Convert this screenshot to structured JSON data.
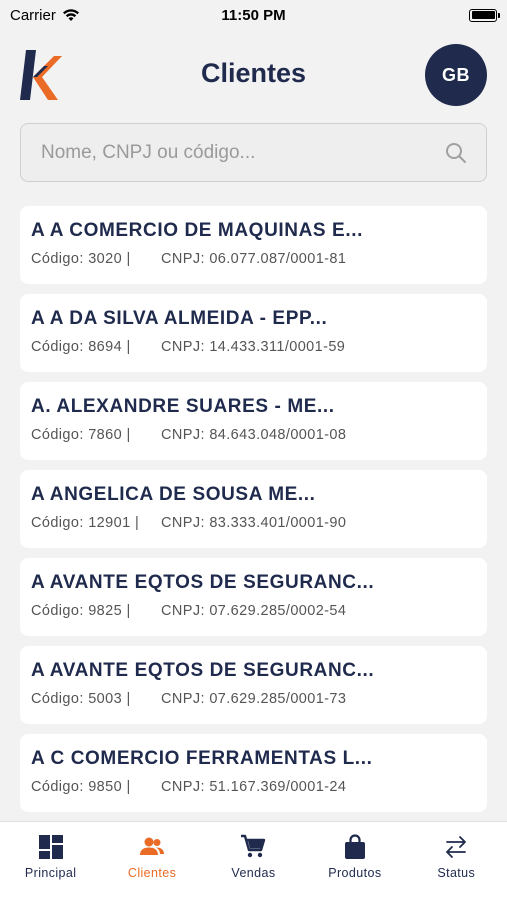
{
  "status_bar": {
    "carrier": "Carrier",
    "time": "11:50 PM"
  },
  "header": {
    "title": "Clientes",
    "avatar_initials": "GB"
  },
  "search": {
    "placeholder": "Nome, CNPJ ou código..."
  },
  "clients": [
    {
      "name": "A A COMERCIO DE MAQUINAS E...",
      "code": "Código: 3020 |",
      "cnpj": "CNPJ: 06.077.087/0001-81"
    },
    {
      "name": "A A DA SILVA ALMEIDA - EPP...",
      "code": "Código: 8694 |",
      "cnpj": "CNPJ: 14.433.311/0001-59"
    },
    {
      "name": "A. ALEXANDRE SUARES - ME...",
      "code": "Código: 7860 |",
      "cnpj": "CNPJ: 84.643.048/0001-08"
    },
    {
      "name": "A ANGELICA DE SOUSA ME...",
      "code": "Código: 12901 |",
      "cnpj": "CNPJ: 83.333.401/0001-90"
    },
    {
      "name": "A AVANTE EQTOS DE SEGURANC...",
      "code": "Código: 9825 |",
      "cnpj": "CNPJ: 07.629.285/0002-54"
    },
    {
      "name": "A AVANTE EQTOS DE SEGURANC...",
      "code": "Código: 5003 |",
      "cnpj": "CNPJ: 07.629.285/0001-73"
    },
    {
      "name": "A C COMERCIO FERRAMENTAS L...",
      "code": "Código: 9850 |",
      "cnpj": "CNPJ: 51.167.369/0001-24"
    }
  ],
  "tabs": [
    {
      "label": "Principal",
      "icon": "dashboard-icon"
    },
    {
      "label": "Clientes",
      "icon": "people-icon",
      "active": true
    },
    {
      "label": "Vendas",
      "icon": "cart-icon"
    },
    {
      "label": "Produtos",
      "icon": "bag-icon"
    },
    {
      "label": "Status",
      "icon": "sync-arrows-icon"
    }
  ],
  "colors": {
    "primary": "#1f2a4d",
    "accent": "#ea6b26",
    "background": "#f2f2f2"
  }
}
